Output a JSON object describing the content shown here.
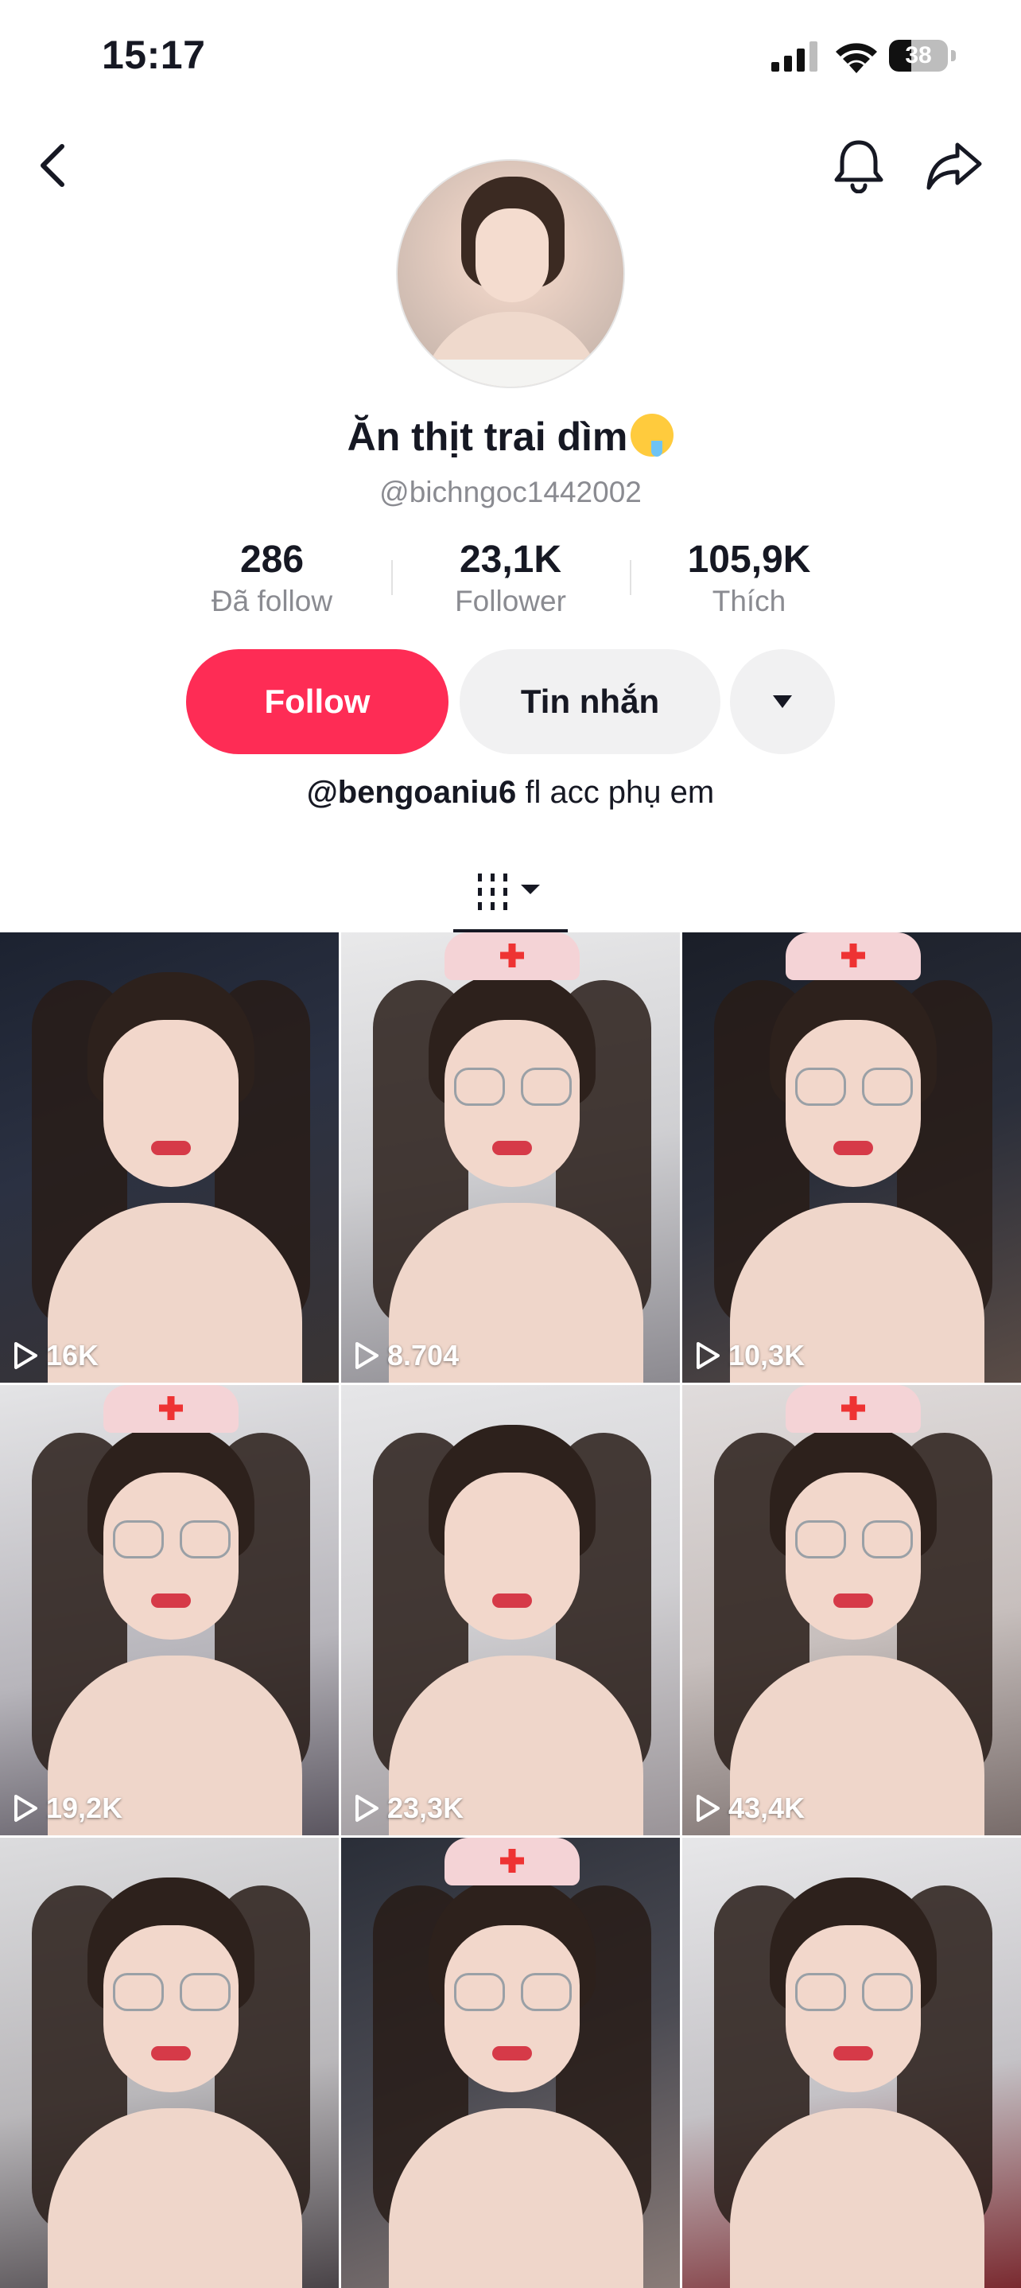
{
  "status_bar": {
    "time": "15:17",
    "battery": "38",
    "battery_level_percent": 38
  },
  "icons": {
    "back": "chevron-left-icon",
    "notifications": "bell-icon",
    "share": "share-arrow-icon",
    "more": "caret-down-icon",
    "videos_tab": "grid-bars-icon",
    "play": "play-icon"
  },
  "profile": {
    "display_name": "Ăn thịt trai dìm",
    "display_name_emoji": "drooling-face-emoji",
    "handle": "@bichngoc1442002"
  },
  "stats": [
    {
      "value": "286",
      "label": "Đã follow"
    },
    {
      "value": "23,1K",
      "label": "Follower"
    },
    {
      "value": "105,9K",
      "label": "Thích"
    }
  ],
  "actions": {
    "follow": "Follow",
    "message": "Tin nhắn"
  },
  "bio": {
    "mention": "@bengoaniu6",
    "text": " fl acc phụ em"
  },
  "colors": {
    "accent": "#fe2c55",
    "secondary_button": "#f1f1f2",
    "muted_text": "#8a8b91"
  },
  "videos": [
    {
      "views": "16K"
    },
    {
      "views": "8.704"
    },
    {
      "views": "10,3K"
    },
    {
      "views": "19,2K"
    },
    {
      "views": "23,3K"
    },
    {
      "views": "43,4K"
    },
    {
      "views": ""
    },
    {
      "views": ""
    },
    {
      "views": ""
    }
  ]
}
